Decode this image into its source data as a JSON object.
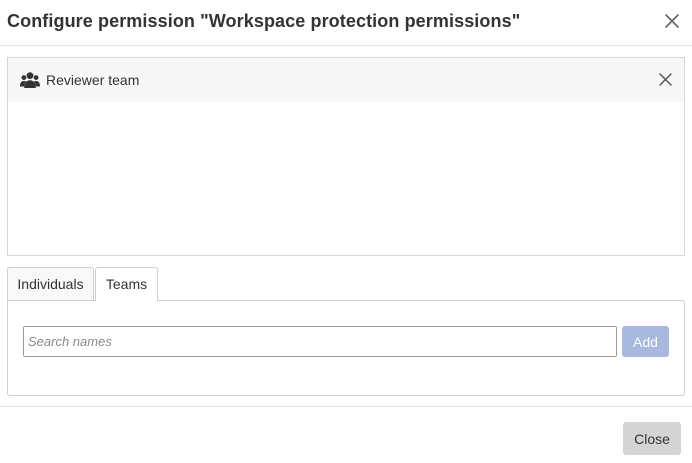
{
  "dialog": {
    "title": "Configure permission \"Workspace protection permissions\""
  },
  "selected": {
    "items": [
      {
        "label": "Reviewer team",
        "icon": "team-icon"
      }
    ]
  },
  "tabs": [
    {
      "label": "Individuals",
      "active": false
    },
    {
      "label": "Teams",
      "active": true
    }
  ],
  "search": {
    "value": "",
    "placeholder": "Search names",
    "add_label": "Add"
  },
  "footer": {
    "close_label": "Close"
  },
  "colors": {
    "add_button_bg": "#a9b9de",
    "close_button_bg": "#d4d4d4",
    "row_bg": "#f7f7f7"
  }
}
